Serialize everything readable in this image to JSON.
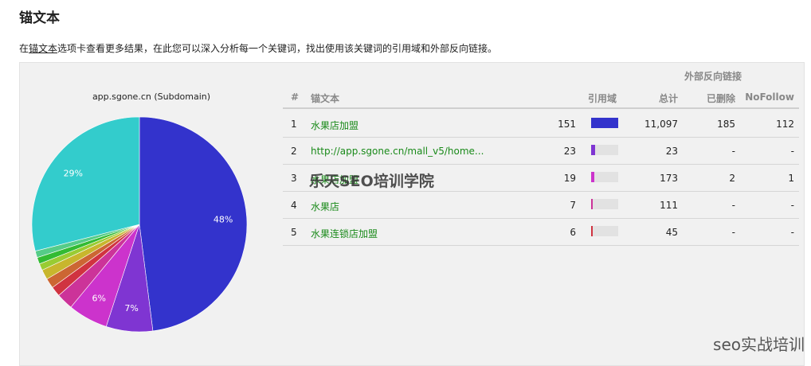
{
  "page": {
    "title": "锚文本",
    "intro_before": "在",
    "intro_link": "锚文本",
    "intro_after": "选项卡查看更多结果，在此您可以深入分析每一个关键词，找出使用该关键词的引用域和外部反向链接。"
  },
  "chart_data": {
    "type": "pie",
    "title": "app.sgone.cn (Subdomain)",
    "slices": [
      {
        "value": 48,
        "label": "48%",
        "color": "#3333cc"
      },
      {
        "value": 7,
        "label": "7%",
        "color": "#7f35d2"
      },
      {
        "value": 6,
        "label": "6%",
        "color": "#cc33cc"
      },
      {
        "value": 2.5,
        "label": "",
        "color": "#cc3399"
      },
      {
        "value": 1.5,
        "label": "",
        "color": "#d03340"
      },
      {
        "value": 1.5,
        "label": "",
        "color": "#cc6633"
      },
      {
        "value": 1.5,
        "label": "",
        "color": "#c8b62d"
      },
      {
        "value": 1,
        "label": "",
        "color": "#99cc33"
      },
      {
        "value": 1,
        "label": "",
        "color": "#33bb33"
      },
      {
        "value": 1,
        "label": "",
        "color": "#55cc88"
      },
      {
        "value": 29,
        "label": "29%",
        "color": "#33cccc"
      }
    ]
  },
  "table": {
    "group_header": "外部反向链接",
    "headers": {
      "num": "#",
      "anchor": "锚文本",
      "ref_domains": "引用域",
      "total": "总计",
      "deleted": "已删除",
      "nofollow": "NoFollow"
    },
    "rows": [
      {
        "num": "1",
        "anchor": "水果店加盟",
        "ref_domains": "151",
        "ref_fraction": 1.0,
        "bar_color": "#3333cc",
        "total": "11,097",
        "deleted": "185",
        "nofollow": "112"
      },
      {
        "num": "2",
        "anchor": "http://app.sgone.cn/mall_v5/home...",
        "ref_domains": "23",
        "ref_fraction": 0.152,
        "bar_color": "#7f35d2",
        "total": "23",
        "deleted": "-",
        "nofollow": "-"
      },
      {
        "num": "3",
        "anchor": "水果店加盟",
        "ref_domains": "19",
        "ref_fraction": 0.126,
        "bar_color": "#cc33cc",
        "total": "173",
        "deleted": "2",
        "nofollow": "1"
      },
      {
        "num": "4",
        "anchor": "水果店",
        "ref_domains": "7",
        "ref_fraction": 0.046,
        "bar_color": "#cc3399",
        "total": "111",
        "deleted": "-",
        "nofollow": "-"
      },
      {
        "num": "5",
        "anchor": "水果连锁店加盟",
        "ref_domains": "6",
        "ref_fraction": 0.04,
        "bar_color": "#d03340",
        "total": "45",
        "deleted": "-",
        "nofollow": "-"
      }
    ]
  },
  "watermark": "乐天SEO培训学院",
  "corner_watermark": "seo实战培训"
}
